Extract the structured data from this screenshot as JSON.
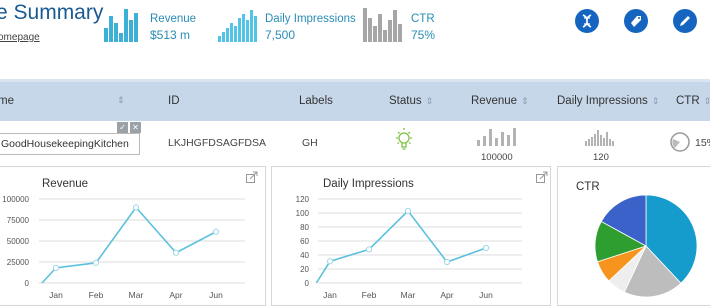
{
  "header": {
    "title": "e Summary",
    "homepage_link": "omepage"
  },
  "stats": [
    {
      "label": "Revenue",
      "value": "$513 m",
      "color": "#3cb0d7"
    },
    {
      "label": "Daily Impressions",
      "value": "7,500",
      "color": "#53c3e8"
    },
    {
      "label": "CTR",
      "value": "75%",
      "color": "#a6a6a6"
    }
  ],
  "action_buttons": [
    {
      "icon": "dna-icon"
    },
    {
      "icon": "tag-icon"
    },
    {
      "icon": "pencil-icon"
    }
  ],
  "table": {
    "columns": [
      {
        "label": "me",
        "sortable": true
      },
      {
        "label": "ID",
        "sortable": false
      },
      {
        "label": "Labels",
        "sortable": false
      },
      {
        "label": "Status",
        "sortable": true
      },
      {
        "label": "Revenue",
        "sortable": true
      },
      {
        "label": "Daily Impressions",
        "sortable": true
      },
      {
        "label": "CTR",
        "sortable": true
      }
    ],
    "sort_glyph": "⇕",
    "row": {
      "name": "GoodHousekeepingKitchen",
      "id": "LKJHGFDSAGFDSA",
      "labels": "GH",
      "status_icon": "lightbulb-icon",
      "status_color": "#7dc242",
      "revenue": "100000",
      "impressions": "120",
      "ctr": "15%",
      "confirm_glyph": "✓",
      "clear_glyph": "✕"
    }
  },
  "charts": {
    "revenue": {
      "title": "Revenue",
      "chart_data": {
        "type": "line",
        "categories": [
          "Jan",
          "Feb",
          "Mar",
          "Apr",
          "Jun"
        ],
        "values": [
          0,
          18000,
          24000,
          90000,
          36000,
          61000
        ],
        "x_positions": [
          -0.35,
          0,
          1,
          2,
          3,
          4
        ],
        "yticks": [
          "0",
          "25000",
          "50000",
          "75000",
          "100000"
        ],
        "ylim": [
          0,
          100000
        ],
        "color": "#5bc0de"
      }
    },
    "impressions": {
      "title": "Daily Impressions",
      "chart_data": {
        "type": "line",
        "categories": [
          "Jan",
          "Feb",
          "Mar",
          "Apr",
          "Jun"
        ],
        "values": [
          0,
          31,
          48,
          103,
          30,
          50
        ],
        "x_positions": [
          -0.35,
          0,
          1,
          2,
          3,
          4
        ],
        "yticks": [
          "0",
          "20",
          "40",
          "60",
          "80",
          "100",
          "120"
        ],
        "ylim": [
          0,
          120
        ],
        "color": "#5bc0de"
      }
    },
    "ctr": {
      "title": "CTR",
      "chart_data": {
        "type": "pie",
        "slices": [
          {
            "value": 38,
            "color": "#159bcc"
          },
          {
            "value": 19,
            "color": "#bdbdbd"
          },
          {
            "value": 6,
            "color": "#eeeeee"
          },
          {
            "value": 7,
            "color": "#f7941d"
          },
          {
            "value": 13,
            "color": "#2e9e31"
          },
          {
            "value": 17,
            "color": "#3a62c9"
          }
        ]
      }
    }
  }
}
